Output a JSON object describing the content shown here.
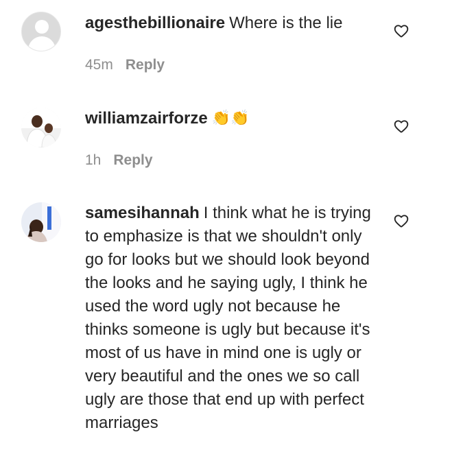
{
  "comments": [
    {
      "username": "agesthebillionaire",
      "text": "Where is the lie",
      "time": "45m",
      "reply_label": "Reply",
      "avatar": "default-avatar-icon"
    },
    {
      "username": "williamzairforze",
      "text": "👏👏",
      "time": "1h",
      "reply_label": "Reply",
      "avatar": "profile-photo"
    },
    {
      "username": "samesihannah",
      "text": "I think what he is trying to emphasize is that we shouldn't only go for looks but we should look beyond the looks and he saying ugly, I think he used the word ugly not because he thinks someone is ugly but because it's most of us have in mind one is ugly or very beautiful and the ones we so call ugly are those that end up with perfect marriages",
      "avatar": "profile-photo"
    }
  ],
  "icons": {
    "like": "heart-outline-icon"
  },
  "colors": {
    "text": "#262626",
    "secondary": "#8e8e8e",
    "background": "#ffffff"
  }
}
